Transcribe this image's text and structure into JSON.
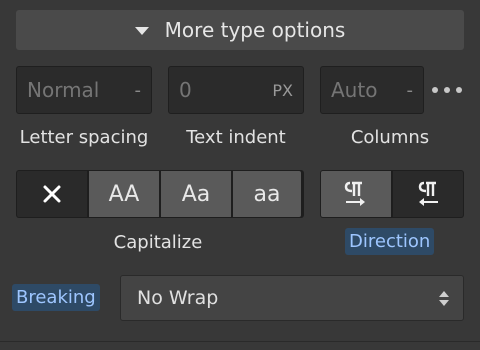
{
  "more_options": {
    "label": "More type options",
    "icon": "triangle-down-icon"
  },
  "letter_spacing": {
    "value": "Normal",
    "unit": "-",
    "label": "Letter spacing"
  },
  "text_indent": {
    "value": "0",
    "unit": "PX",
    "label": "Text indent"
  },
  "columns": {
    "value": "Auto",
    "unit": "-",
    "label": "Columns"
  },
  "capitalize": {
    "label": "Capitalize",
    "options": [
      {
        "text": "✕",
        "icon": "none-x-icon",
        "active": true
      },
      {
        "text": "AA",
        "icon": "uppercase-icon",
        "active": false
      },
      {
        "text": "Aa",
        "icon": "capitalize-icon",
        "active": false
      },
      {
        "text": "aa",
        "icon": "lowercase-icon",
        "active": false
      }
    ]
  },
  "direction": {
    "label": "Direction",
    "options": [
      {
        "icon": "ltr-paragraph-icon",
        "active": false
      },
      {
        "icon": "rtl-paragraph-icon",
        "active": true
      }
    ]
  },
  "breaking": {
    "label": "Breaking",
    "value": "No Wrap"
  },
  "colors": {
    "highlight_bg": "#2e4a66",
    "highlight_text": "#9ec6ff"
  }
}
